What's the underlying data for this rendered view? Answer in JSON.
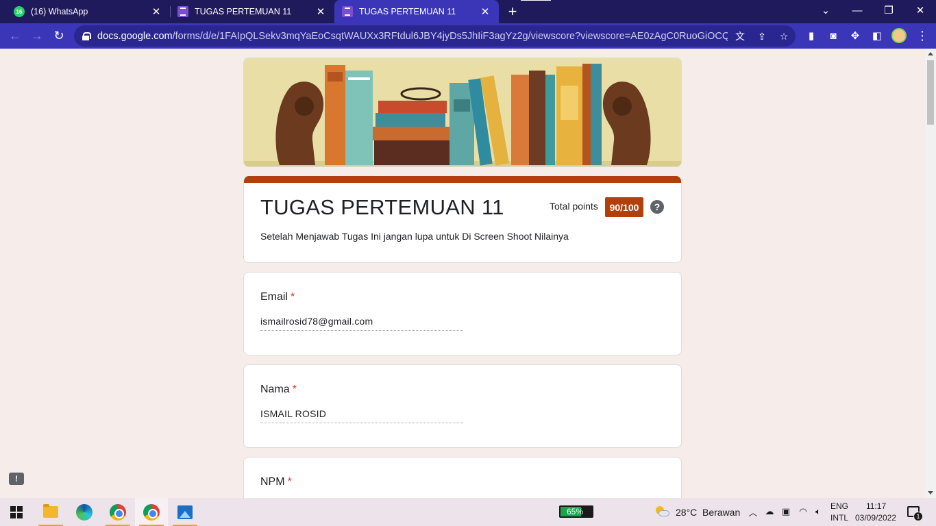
{
  "browser": {
    "tabs": [
      {
        "title": "(16) WhatsApp",
        "badge": "16",
        "icon": "whatsapp-icon",
        "active": false
      },
      {
        "title": "TUGAS PERTEMUAN 11",
        "icon": "google-forms-icon",
        "active": false
      },
      {
        "title": "TUGAS PERTEMUAN 11",
        "icon": "google-forms-icon",
        "active": true
      }
    ],
    "close_glyph": "✕",
    "new_tab_glyph": "+",
    "url_host": "docs.google.com",
    "url_path": "/forms/d/e/1FAIpQLSekv3mqYaEoCsqtWAUXx3RFtdul6JBY4jyDs5JhIiF3agYz2g/viewscore?viewscore=AE0zAgC0RuoGiOCQIjh9r1va..."
  },
  "form": {
    "title": "TUGAS PERTEMUAN 11",
    "total_points_label": "Total points",
    "score": "90/100",
    "help_glyph": "?",
    "description": "Setelah Menjawab Tugas Ini jangan lupa untuk Di Screen Shoot Nilainya",
    "required_marker": "*",
    "questions": [
      {
        "label": "Email",
        "answer": "ismailrosid78@gmail.com"
      },
      {
        "label": "Nama",
        "answer": "ISMAIL ROSID"
      },
      {
        "label": "NPM",
        "answer": ""
      }
    ]
  },
  "taskbar": {
    "battery_percent": "65%",
    "battery_level": 0.65,
    "temperature": "28°C",
    "weather": "Berawan",
    "language_top": "ENG",
    "language_bottom": "INTL",
    "time": "11:17",
    "date": "03/09/2022",
    "notification_count": "1"
  },
  "colors": {
    "accent": "#b2400a",
    "tab_bar": "#1f1a5c",
    "toolbar": "#3b36b8",
    "page_background": "#f6ece9"
  }
}
